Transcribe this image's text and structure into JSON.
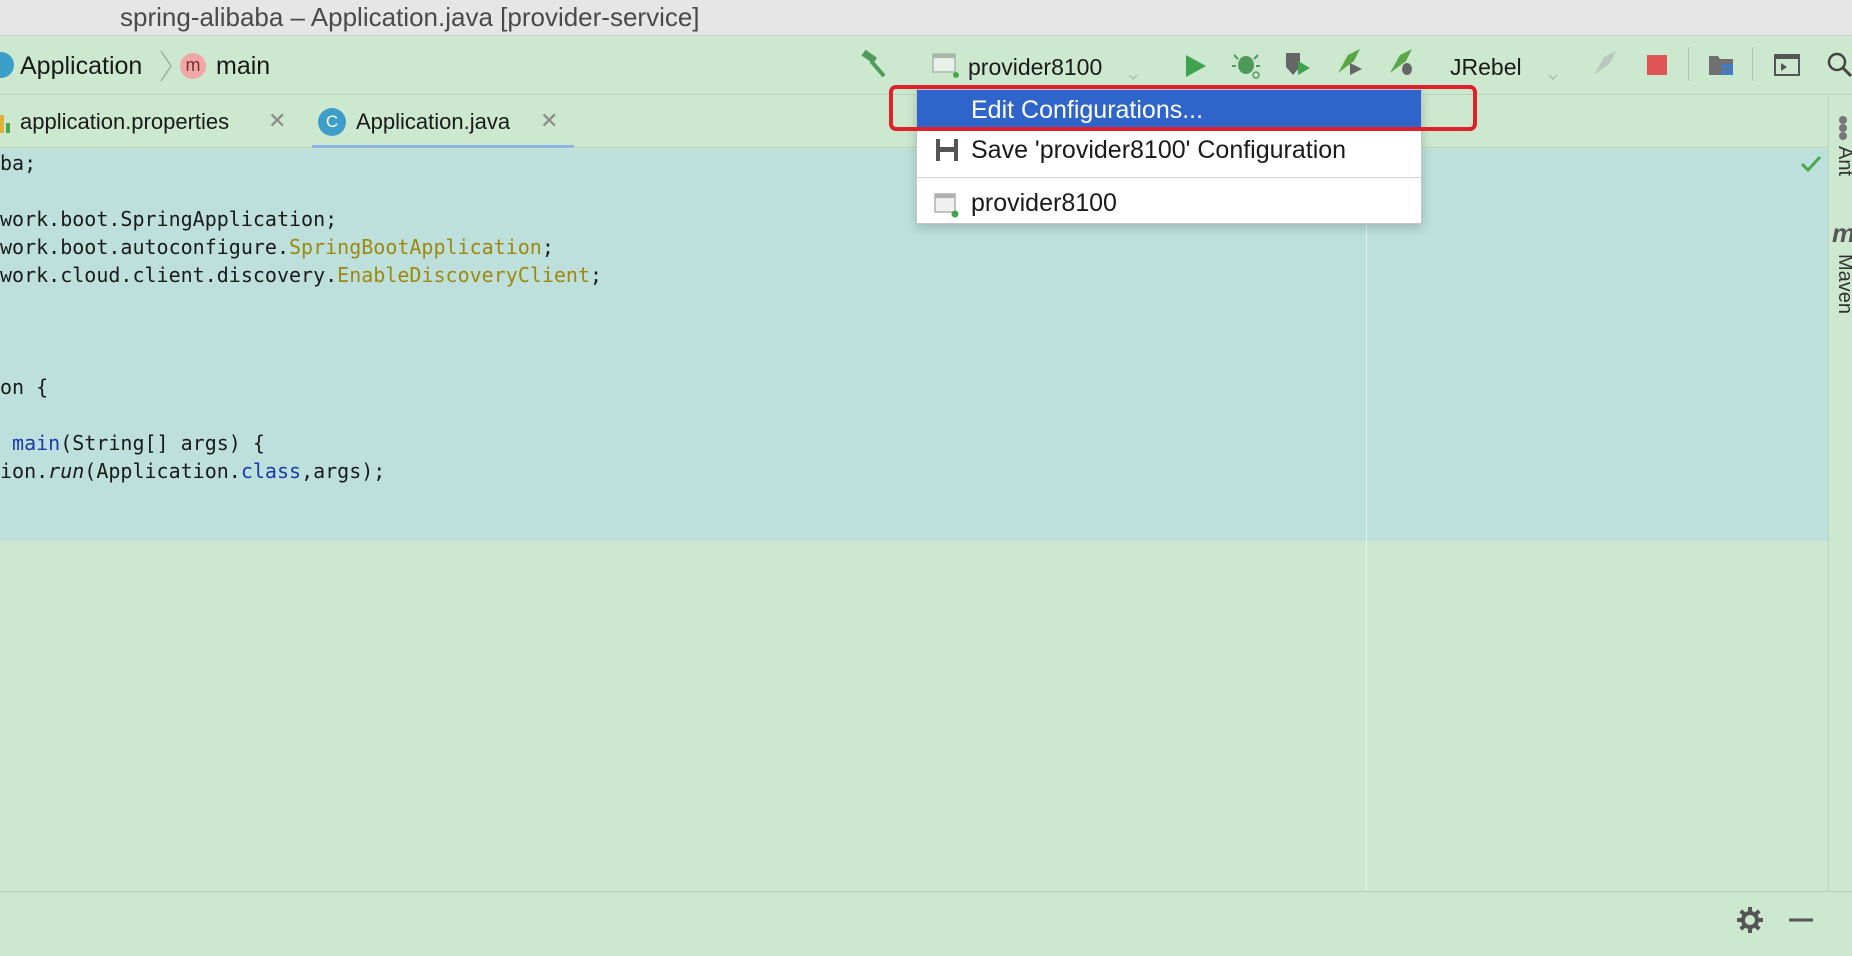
{
  "window": {
    "title": "spring-alibaba – Application.java [provider-service]"
  },
  "breadcrumb": {
    "class_label": "Application",
    "method_icon_letter": "m",
    "method_label": "main"
  },
  "toolbar": {
    "run_config": "provider8100",
    "jrebel_label": "JRebel"
  },
  "tabs": [
    {
      "label": "application.properties",
      "icon": "properties-file-icon"
    },
    {
      "label": "Application.java",
      "icon_letter": "C",
      "icon": "java-class-icon"
    }
  ],
  "code_lines": {
    "l1": "ba;",
    "l3": "work.boot.SpringApplication;",
    "l4a": "work.boot.autoconfigure.",
    "l4b": "SpringBootApplication",
    "l4c": ";",
    "l5a": "work.cloud.client.discovery.",
    "l5b": "EnableDiscoveryClient",
    "l5c": ";",
    "l9": "on {",
    "l11a": " ",
    "l11b": "main",
    "l11c": "(String[] args) {",
    "l12a": "ion.",
    "l12b": "run",
    "l12c": "(Application.",
    "l12d": "class",
    "l12e": ",args);"
  },
  "right_panel": {
    "ant_label": "Ant",
    "maven_label": "Maven",
    "maven_icon_letter": "m"
  },
  "popup": {
    "items": [
      {
        "label": "Edit Configurations...",
        "selected": true
      },
      {
        "label": "Save 'provider8100' Configuration",
        "selected": false
      },
      {
        "label": "provider8100",
        "selected": false
      }
    ]
  },
  "colors": {
    "background": "#cce8cf",
    "editor_highlight": "#bde0dd",
    "selection_blue": "#2f65ca",
    "callout_red": "#e0202b"
  }
}
